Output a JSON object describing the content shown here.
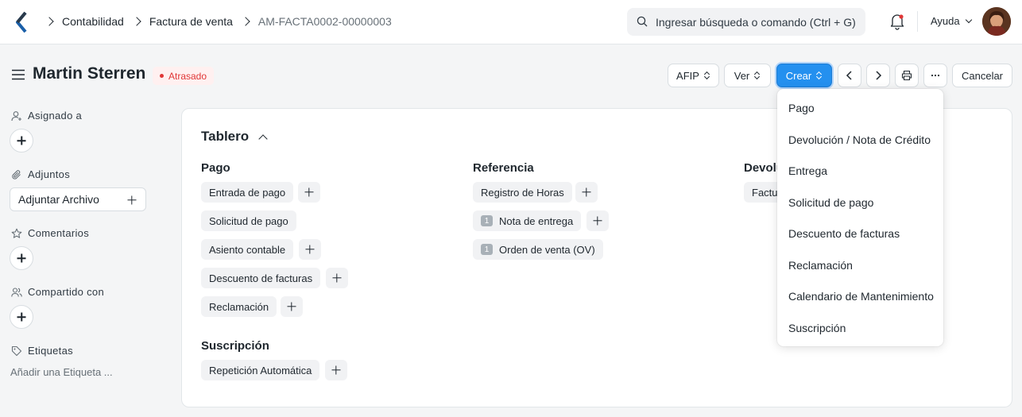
{
  "breadcrumbs": [
    "Contabilidad",
    "Factura de venta",
    "AM-FACTA0002-00000003"
  ],
  "search": {
    "placeholder": "Ingresar búsqueda o comando (Ctrl + G)"
  },
  "help_label": "Ayuda",
  "page": {
    "title": "Martin Sterren",
    "status": "Atrasado"
  },
  "toolbar": {
    "afip": "AFIP",
    "ver": "Ver",
    "crear": "Crear",
    "cancel": "Cancelar"
  },
  "sidebar": {
    "assigned": "Asignado a",
    "attachments": "Adjuntos",
    "attach_button": "Adjuntar Archivo",
    "comments": "Comentarios",
    "shared": "Compartido con",
    "tags": "Etiquetas",
    "add_tag": "Añadir una Etiqueta ..."
  },
  "dashboard": {
    "title": "Tablero",
    "pago": {
      "title": "Pago",
      "items": [
        "Entrada de pago",
        "Solicitud de pago",
        "Asiento contable",
        "Descuento de facturas",
        "Reclamación"
      ]
    },
    "referencia": {
      "title": "Referencia",
      "items": [
        "Registro de Horas",
        "Nota de entrega",
        "Orden de venta (OV)"
      ],
      "counts": [
        "1",
        "1"
      ]
    },
    "devolucion": {
      "title": "Devolu",
      "items": [
        "Factu"
      ]
    },
    "suscripcion": {
      "title": "Suscripción",
      "items": [
        "Repetición Automática"
      ]
    }
  },
  "crear_menu": [
    "Pago",
    "Devolución / Nota de Crédito",
    "Entrega",
    "Solicitud de pago",
    "Descuento de facturas",
    "Reclamación",
    "Calendario de Mantenimiento",
    "Suscripción"
  ],
  "colors": {
    "primary": "#2490ef",
    "status_red": "#e03636"
  }
}
